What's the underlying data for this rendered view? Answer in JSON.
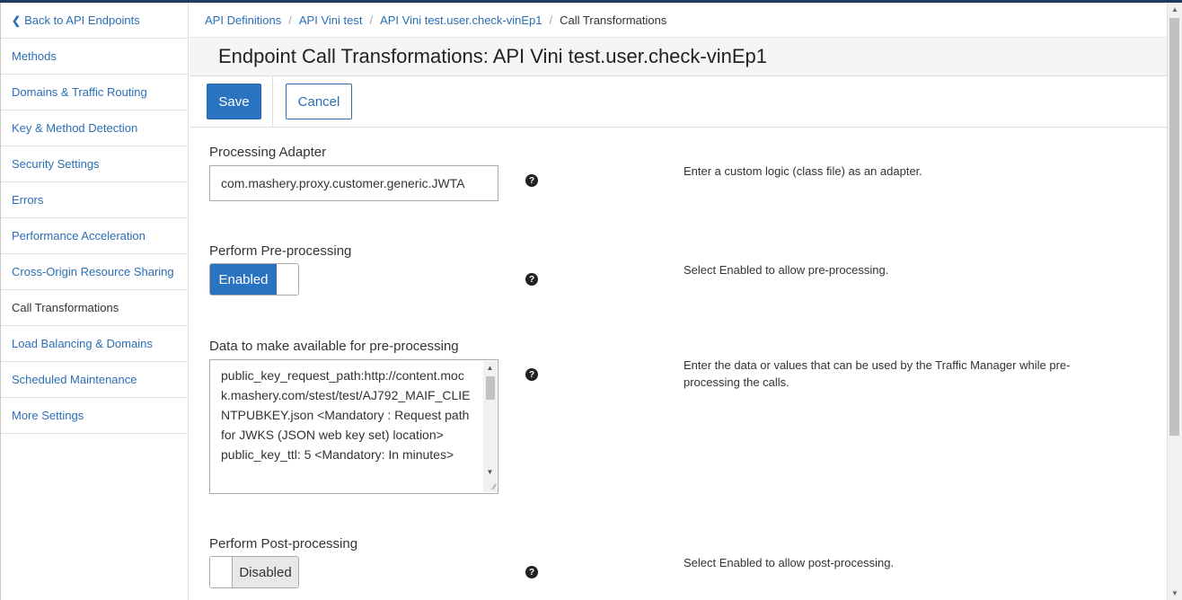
{
  "sidebar": {
    "back_label": "Back to API Endpoints",
    "items": [
      {
        "label": "Methods"
      },
      {
        "label": "Domains & Traffic Routing"
      },
      {
        "label": "Key & Method Detection"
      },
      {
        "label": "Security Settings"
      },
      {
        "label": "Errors"
      },
      {
        "label": "Performance Acceleration"
      },
      {
        "label": "Cross-Origin Resource Sharing"
      },
      {
        "label": "Call Transformations"
      },
      {
        "label": "Load Balancing & Domains"
      },
      {
        "label": "Scheduled Maintenance"
      },
      {
        "label": "More Settings"
      }
    ],
    "active_index": 7
  },
  "breadcrumb": [
    "API Definitions",
    "API Vini test",
    "API Vini test.user.check-vinEp1",
    "Call Transformations"
  ],
  "page_title": "Endpoint Call Transformations: API Vini test.user.check-vinEp1",
  "actions": {
    "save_label": "Save",
    "cancel_label": "Cancel"
  },
  "form": {
    "processing_adapter": {
      "label": "Processing Adapter",
      "value": "com.mashery.proxy.customer.generic.JWTA",
      "help": "Enter a custom logic (class file) as an adapter."
    },
    "pre_processing": {
      "label": "Perform Pre-processing",
      "state": "Enabled",
      "help": "Select Enabled to allow pre-processing."
    },
    "pre_processing_data": {
      "label": "Data to make available for pre-processing",
      "value": "public_key_request_path:http://content.mock.mashery.com/stest/test/AJ792_MAIF_CLIENTPUBKEY.json <Mandatory : Request path for JWKS (JSON web key set) location>\npublic_key_ttl: 5 <Mandatory: In minutes>",
      "help": "Enter the data or values that can be used by the Traffic Manager while pre-processing the calls."
    },
    "post_processing": {
      "label": "Perform Post-processing",
      "state": "Disabled",
      "help": "Select Enabled to allow post-processing."
    }
  },
  "icons": {
    "back": "chevron-left-icon",
    "help": "question-circle-icon"
  },
  "colors": {
    "primary": "#2a73c0",
    "link": "#2a6fb5",
    "title_bg": "#f5f5f5"
  }
}
